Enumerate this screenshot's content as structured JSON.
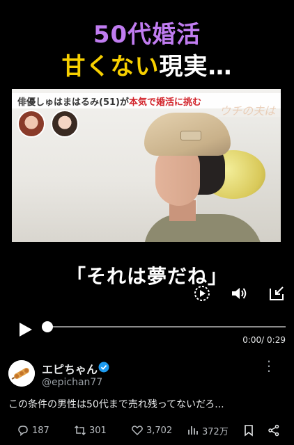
{
  "video": {
    "title_line1": "50代婚活",
    "title_line2_highlight": "甘くない",
    "title_line2_rest": "現実…",
    "caption_prefix": "俳優しゅはまはるみ(51)が",
    "caption_highlight": "本気で婚活に挑む",
    "show_logo": "ウチの夫は",
    "subtitle": "「それは夢だね」",
    "icons": [
      "playback-speed-icon",
      "volume-icon",
      "minimize-icon"
    ]
  },
  "player": {
    "time": "0:00/ 0:29",
    "progress": 0.0
  },
  "post": {
    "name": "エピちゃん",
    "handle": "@epichan77",
    "text": "この条件の男性は50代まで売れ残ってないだろ...",
    "more": "⋮"
  },
  "actions": {
    "replies": "187",
    "reposts": "301",
    "likes": "3,702",
    "views": "372万"
  },
  "colors": {
    "title_purple": "#c07cf0",
    "title_yellow": "#f7d000",
    "caption_red": "#d2232a",
    "verified_blue": "#1d9bf0",
    "background": "#000000"
  }
}
